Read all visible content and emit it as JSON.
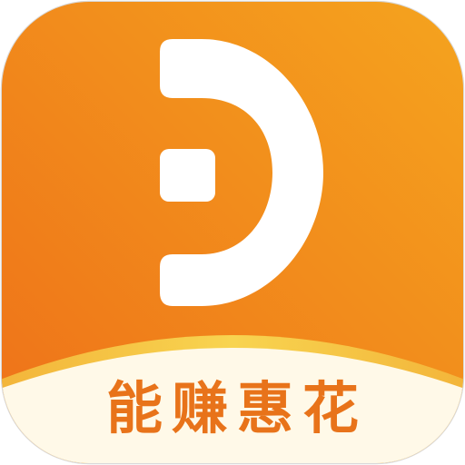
{
  "app_icon": {
    "slogan": "能赚惠花",
    "logo_icon": "letter-d-icon",
    "colors": {
      "gradient_top": "#f5a41e",
      "gradient_bottom": "#ee7019",
      "banner_fill": "#fff9e8",
      "banner_edge": "#f6c93c",
      "logo": "#ffffff",
      "slogan_text": "#e8731a",
      "border": "#d9d9d9"
    }
  }
}
